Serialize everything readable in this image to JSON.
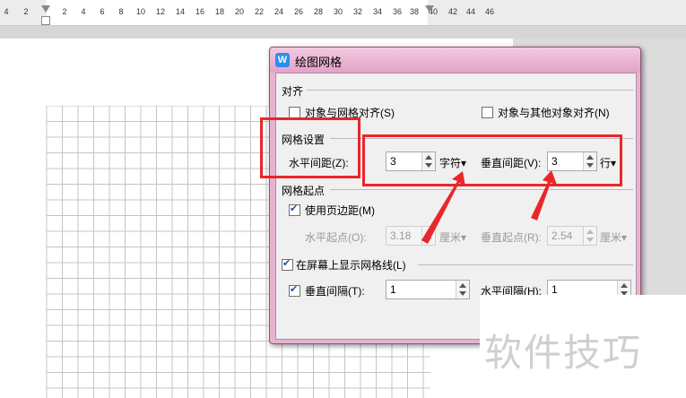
{
  "ruler": {
    "ticks": [
      "4",
      "2",
      "2",
      "4",
      "6",
      "8",
      "10",
      "12",
      "14",
      "16",
      "18",
      "20",
      "22",
      "24",
      "26",
      "28",
      "30",
      "32",
      "34",
      "36",
      "38",
      "40",
      "42",
      "44",
      "46"
    ]
  },
  "dialog": {
    "title": "绘图网格",
    "app_icon_letter": "W",
    "align": {
      "heading": "对齐",
      "snap_to_grid": {
        "label": "对象与网格对齐(S)",
        "checked": false
      },
      "snap_to_other": {
        "label": "对象与其他对象对齐(N)",
        "checked": false
      }
    },
    "grid_settings": {
      "heading": "网格设置",
      "horizontal_spacing": {
        "label": "水平间距(Z):",
        "value": "3",
        "unit": "字符▾"
      },
      "vertical_spacing": {
        "label": "垂直间距(V):",
        "value": "3",
        "unit": "行▾"
      }
    },
    "grid_origin": {
      "heading": "网格起点",
      "use_margins": {
        "label": "使用页边距(M)",
        "checked": true
      },
      "horizontal_origin": {
        "label": "水平起点(O):",
        "value": "3.18",
        "unit": "厘米▾"
      },
      "vertical_origin": {
        "label": "垂直起点(R):",
        "value": "2.54",
        "unit": "厘米▾"
      }
    },
    "show_gridlines": {
      "label": "在屏幕上显示网格线(L)",
      "checked": true,
      "vertical_every": {
        "label": "垂直间隔(T):",
        "value": "1",
        "checked": true
      },
      "horizontal_every": {
        "label": "水平间隔(H):",
        "value": "1"
      }
    }
  },
  "watermark": "软件技巧",
  "colors": {
    "highlight": "#e9262a",
    "dialog_frame": "#e7b3d0"
  }
}
